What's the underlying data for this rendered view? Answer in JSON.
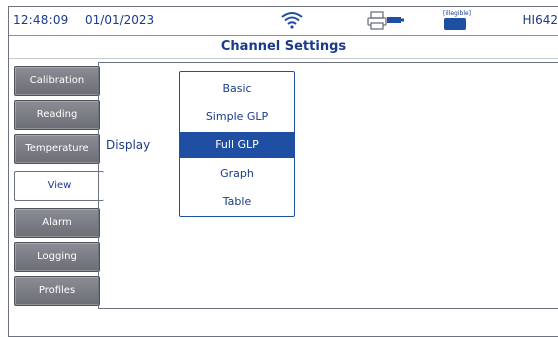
{
  "status_bar": {
    "time": "12:48:09",
    "date": "01/01/2023",
    "icons": [
      "wifi-icon",
      "printer-icon",
      "battery-icon"
    ],
    "badge_label": "[illegible]",
    "model": "HI642"
  },
  "screen": {
    "title": "Channel Settings"
  },
  "tabs": [
    {
      "label": "Calibration",
      "active": false
    },
    {
      "label": "Reading",
      "active": false
    },
    {
      "label": "Temperature",
      "active": false
    },
    {
      "label": "View",
      "active": true
    },
    {
      "label": "Alarm",
      "active": false
    },
    {
      "label": "Logging",
      "active": false
    },
    {
      "label": "Profiles",
      "active": false
    }
  ],
  "view": {
    "display_label": "Display",
    "display_options": [
      "Basic",
      "Simple GLP",
      "Full GLP",
      "Graph",
      "Table"
    ],
    "selected_option": "Full GLP"
  },
  "colors": {
    "accent": "#1f4fa3",
    "text": "#1a3a8a",
    "tab_gray": "#7a7d83"
  }
}
